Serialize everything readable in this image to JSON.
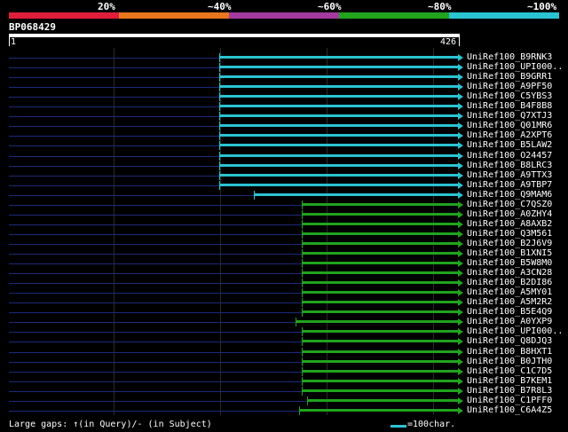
{
  "legend": {
    "labels": [
      "20%",
      "~40%",
      "~60%",
      "~80%",
      "~100%"
    ],
    "colors": [
      "#e01e3c",
      "#e8761e",
      "#a23aa0",
      "#21a31e",
      "#2ac3d2"
    ]
  },
  "query": {
    "title": "BP068429",
    "ruler_start": "1",
    "ruler_end": "426"
  },
  "hits": [
    {
      "label": "UniRef100_B9RNK3",
      "group": "cyan",
      "start": 0.468
    },
    {
      "label": "UniRef100_UPI000..",
      "group": "cyan",
      "start": 0.468
    },
    {
      "label": "UniRef100_B9GRR1",
      "group": "cyan",
      "start": 0.468
    },
    {
      "label": "UniRef100_A9PF50",
      "group": "cyan",
      "start": 0.468
    },
    {
      "label": "UniRef100_C5YBS3",
      "group": "cyan",
      "start": 0.468
    },
    {
      "label": "UniRef100_B4F8B8",
      "group": "cyan",
      "start": 0.468
    },
    {
      "label": "UniRef100_Q7XTJ3",
      "group": "cyan",
      "start": 0.468
    },
    {
      "label": "UniRef100_Q01MR6",
      "group": "cyan",
      "start": 0.468
    },
    {
      "label": "UniRef100_A2XPT6",
      "group": "cyan",
      "start": 0.468
    },
    {
      "label": "UniRef100_B5LAW2",
      "group": "cyan",
      "start": 0.468
    },
    {
      "label": "UniRef100_O24457",
      "group": "cyan",
      "start": 0.468
    },
    {
      "label": "UniRef100_B8LRC3",
      "group": "cyan",
      "start": 0.468
    },
    {
      "label": "UniRef100_A9TTX3",
      "group": "cyan",
      "start": 0.468
    },
    {
      "label": "UniRef100_A9TBP7",
      "group": "cyan",
      "start": 0.468
    },
    {
      "label": "UniRef100_Q9MAM6",
      "group": "cyan",
      "start": 0.546
    },
    {
      "label": "UniRef100_C7QSZ0",
      "group": "green",
      "start": 0.652
    },
    {
      "label": "UniRef100_A0ZHY4",
      "group": "green",
      "start": 0.652
    },
    {
      "label": "UniRef100_A8AXB2",
      "group": "green",
      "start": 0.652
    },
    {
      "label": "UniRef100_Q3M561",
      "group": "green",
      "start": 0.652
    },
    {
      "label": "UniRef100_B2J6V9",
      "group": "green",
      "start": 0.652
    },
    {
      "label": "UniRef100_B1XNI5",
      "group": "green",
      "start": 0.652
    },
    {
      "label": "UniRef100_B5W8M0",
      "group": "green",
      "start": 0.652
    },
    {
      "label": "UniRef100_A3CN28",
      "group": "green",
      "start": 0.652
    },
    {
      "label": "UniRef100_B2DI86",
      "group": "green",
      "start": 0.652
    },
    {
      "label": "UniRef100_A5MY01",
      "group": "green",
      "start": 0.652
    },
    {
      "label": "UniRef100_A5M2R2",
      "group": "green",
      "start": 0.652
    },
    {
      "label": "UniRef100_B5E4Q9",
      "group": "green",
      "start": 0.652
    },
    {
      "label": "UniRef100_A0YXP9",
      "group": "green",
      "start": 0.638
    },
    {
      "label": "UniRef100_UPI000..",
      "group": "green",
      "start": 0.652
    },
    {
      "label": "UniRef100_Q8DJQ3",
      "group": "green",
      "start": 0.652
    },
    {
      "label": "UniRef100_B8HXT1",
      "group": "green",
      "start": 0.652
    },
    {
      "label": "UniRef100_B0JTH0",
      "group": "green",
      "start": 0.652
    },
    {
      "label": "UniRef100_C1C7D5",
      "group": "green",
      "start": 0.652
    },
    {
      "label": "UniRef100_B7KEM1",
      "group": "green",
      "start": 0.652
    },
    {
      "label": "UniRef100_B7R8L3",
      "group": "green",
      "start": 0.652
    },
    {
      "label": "UniRef100_C1PFF0",
      "group": "green",
      "start": 0.664
    },
    {
      "label": "UniRef100_C6A4Z5",
      "group": "green",
      "start": 0.646
    }
  ],
  "footer": {
    "gaps_text": "Large gaps: ↑(in Query)/- (in Subject)",
    "scale_text": "=100char."
  }
}
